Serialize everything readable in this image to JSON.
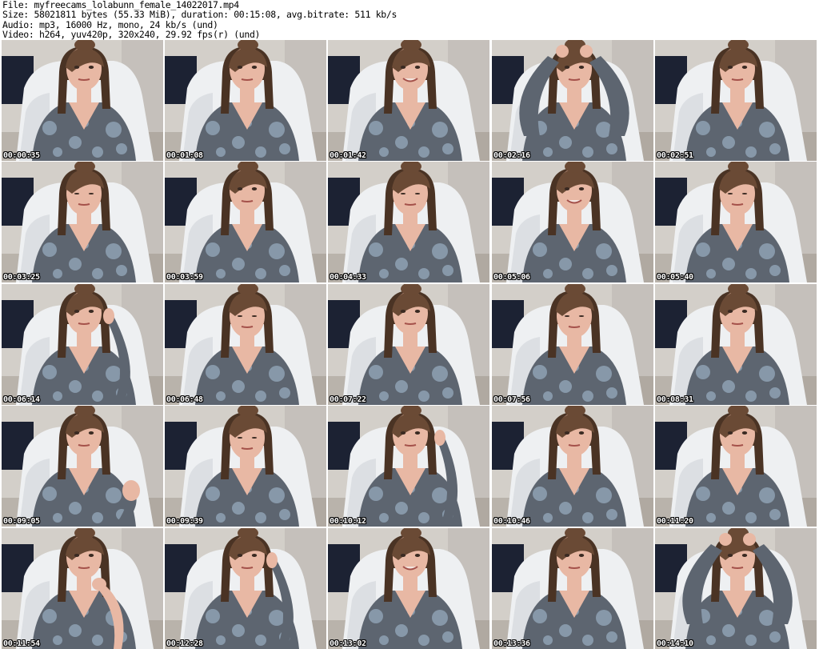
{
  "file_info": {
    "file": "File: myfreecams_lolabunn_female_14022017.mp4",
    "size": "Size: 58021811 bytes (55.33 MiB), duration: 00:15:08, avg.bitrate: 511 kb/s",
    "audio": "Audio: mp3, 16000 Hz, mono, 24 kb/s (und)",
    "video": "Video: h264, yuv420p, 320x240, 29.92 fps(r) (und)"
  },
  "thumbnails": [
    {
      "timestamp": "00:00:35",
      "pose": "neutral"
    },
    {
      "timestamp": "00:01:08",
      "pose": "neutral"
    },
    {
      "timestamp": "00:01:42",
      "pose": "smile"
    },
    {
      "timestamp": "00:02:16",
      "pose": "arms-up"
    },
    {
      "timestamp": "00:02:51",
      "pose": "neutral"
    },
    {
      "timestamp": "00:03:25",
      "pose": "look-down"
    },
    {
      "timestamp": "00:03:59",
      "pose": "neutral"
    },
    {
      "timestamp": "00:04:33",
      "pose": "look-down"
    },
    {
      "timestamp": "00:05:06",
      "pose": "smile"
    },
    {
      "timestamp": "00:05:40",
      "pose": "look-down"
    },
    {
      "timestamp": "00:06:14",
      "pose": "hand-hair-left"
    },
    {
      "timestamp": "00:06:48",
      "pose": "look-down"
    },
    {
      "timestamp": "00:07:22",
      "pose": "neutral"
    },
    {
      "timestamp": "00:07:56",
      "pose": "look-down"
    },
    {
      "timestamp": "00:08:31",
      "pose": "neutral"
    },
    {
      "timestamp": "00:09:05",
      "pose": "hand-raised"
    },
    {
      "timestamp": "00:09:39",
      "pose": "look-down"
    },
    {
      "timestamp": "00:10:12",
      "pose": "hand-hair-right"
    },
    {
      "timestamp": "00:10:46",
      "pose": "neutral"
    },
    {
      "timestamp": "00:11:20",
      "pose": "neutral"
    },
    {
      "timestamp": "00:11:54",
      "pose": "hand-chin"
    },
    {
      "timestamp": "00:12:28",
      "pose": "hand-hair-left"
    },
    {
      "timestamp": "00:13:02",
      "pose": "smile"
    },
    {
      "timestamp": "00:13:36",
      "pose": "neutral"
    },
    {
      "timestamp": "00:14:10",
      "pose": "arms-up"
    }
  ],
  "colors": {
    "wall": "#d3cfc9",
    "wall_shadow": "#b9b4ae",
    "chair": "#eef0f2",
    "chair_shadow": "#c9cdd3",
    "dark_object": "#1c2233",
    "hair": "#6a4a35",
    "hair_dark": "#4a3324",
    "skin": "#e8b8a4",
    "shirt": "#5d6570",
    "shirt_pattern": "#a9c3d8",
    "timestamp_text": "#ffffff"
  }
}
